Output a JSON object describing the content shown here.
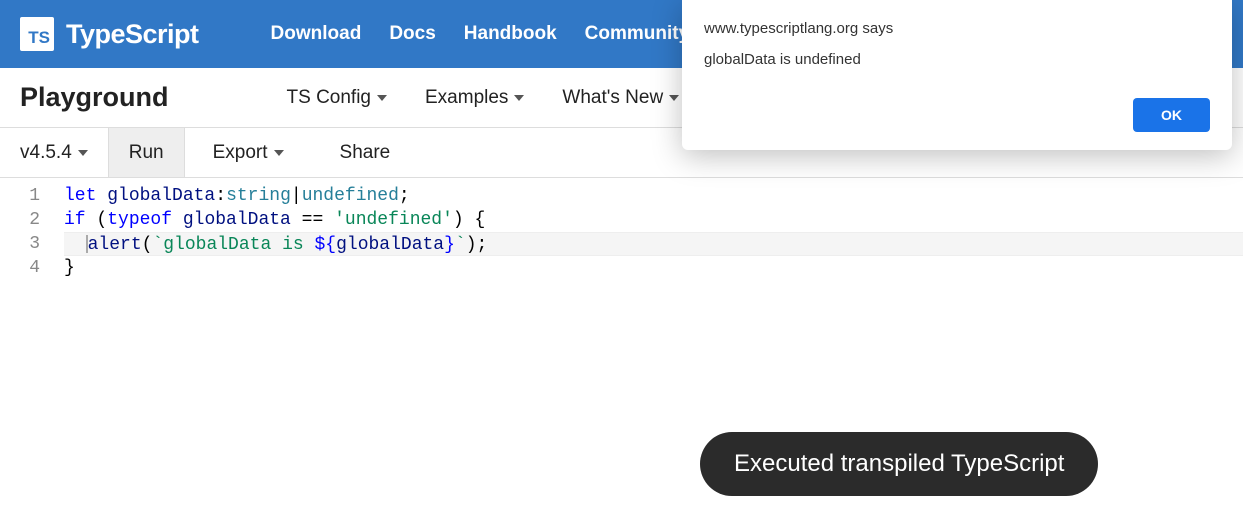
{
  "brand": "TypeScript",
  "logo": "TS",
  "topnav": {
    "download": "Download",
    "docs": "Docs",
    "handbook": "Handbook",
    "community": "Community"
  },
  "subnav": {
    "title": "Playground",
    "tsconfig": "TS Config",
    "examples": "Examples",
    "whatsnew": "What's New"
  },
  "toolbar": {
    "version": "v4.5.4",
    "run": "Run",
    "export": "Export",
    "share": "Share"
  },
  "editor": {
    "lines": [
      "1",
      "2",
      "3",
      "4"
    ],
    "line1": {
      "let": "let ",
      "var": "globalData",
      "colon": ":",
      "t1": "string",
      "pipe": "|",
      "t2": "undefined",
      "semi": ";"
    },
    "line2": {
      "if": "if ",
      "open": "(",
      "typeof": "typeof ",
      "var": "globalData",
      "eq": " == ",
      "str": "'undefined'",
      "close": ") {"
    },
    "line3": {
      "indent": "  ",
      "alert": "alert",
      "open": "(",
      "tick1": "`",
      "txt": "globalData is ",
      "dollar": "${",
      "var": "globalData",
      "closeinterp": "}",
      "tick2": "`",
      "close": ");"
    },
    "line4": {
      "brace": "}"
    }
  },
  "alert": {
    "origin": "www.typescriptlang.org says",
    "message": "globalData is undefined",
    "ok": "OK"
  },
  "toast": "Executed transpiled TypeScript"
}
